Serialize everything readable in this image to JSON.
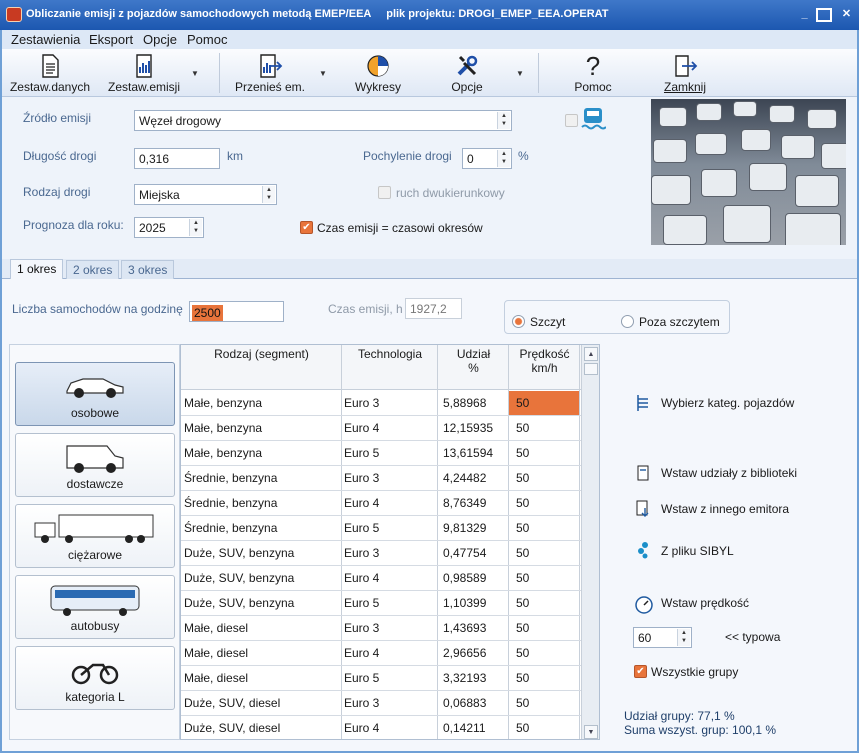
{
  "title_bar": {
    "text": "Obliczanie emisji z pojazdów samochodowych metodą EMEP/EEA     plik projektu: DROGI_EMEP_EEA.OPERAT"
  },
  "menu": [
    "Zestawienia",
    "Eksport",
    "Opcje",
    "Pomoc"
  ],
  "toolbar": {
    "zestaw_danych": "Zestaw.danych",
    "zestaw_emisji": "Zestaw.emisji",
    "przenies": "Przenieś em.",
    "wykresy": "Wykresy",
    "opcje": "Opcje",
    "pomoc": "Pomoc",
    "zamknij": "Zamknij"
  },
  "form": {
    "zrodlo_label": "Źródło emisji",
    "zrodlo_value": "Węzeł drogowy",
    "dlugosc_label": "Długość drogi",
    "dlugosc_value": "0,316",
    "dlugosc_unit": "km",
    "pochylenie_label": "Pochylenie drogi",
    "pochylenie_value": "0",
    "pochylenie_unit": "%",
    "rodzaj_label": "Rodzaj drogi",
    "rodzaj_value": "Miejska",
    "dwukierunkowy_label": "ruch dwukierunkowy",
    "prognoza_label": "Prognoza dla roku:",
    "prognoza_value": "2025",
    "czas_emisji_check_label": "Czas emisji = czasowi okresów"
  },
  "tabs": [
    "1 okres",
    "2 okres",
    "3 okres"
  ],
  "period": {
    "liczba_label": "Liczba samochodów na godzinę",
    "liczba_value": "2500",
    "czas_label": "Czas emisji, h",
    "czas_value": "1927,2",
    "radio_szczyt": "Szczyt",
    "radio_poza": "Poza szczytem"
  },
  "categories": [
    "osobowe",
    "dostawcze",
    "ciężarowe",
    "autobusy",
    "kategoria L"
  ],
  "grid": {
    "headers": {
      "rodzaj": "Rodzaj (segment)",
      "technologia": "Technologia",
      "udzial": "Udział\n%",
      "predkosc": "Prędkość\nkm/h"
    },
    "rows": [
      [
        "Małe, benzyna",
        "Euro 3",
        "5,88968",
        "50"
      ],
      [
        "Małe, benzyna",
        "Euro 4",
        "12,15935",
        "50"
      ],
      [
        "Małe, benzyna",
        "Euro 5",
        "13,61594",
        "50"
      ],
      [
        "Średnie, benzyna",
        "Euro 3",
        "4,24482",
        "50"
      ],
      [
        "Średnie, benzyna",
        "Euro 4",
        "8,76349",
        "50"
      ],
      [
        "Średnie, benzyna",
        "Euro 5",
        "9,81329",
        "50"
      ],
      [
        "Duże, SUV, benzyna",
        "Euro 3",
        "0,47754",
        "50"
      ],
      [
        "Duże, SUV, benzyna",
        "Euro 4",
        "0,98589",
        "50"
      ],
      [
        "Duże, SUV, benzyna",
        "Euro 5",
        "1,10399",
        "50"
      ],
      [
        "Małe, diesel",
        "Euro 3",
        "1,43693",
        "50"
      ],
      [
        "Małe, diesel",
        "Euro 4",
        "2,96656",
        "50"
      ],
      [
        "Małe, diesel",
        "Euro 5",
        "3,32193",
        "50"
      ],
      [
        "Duże, SUV, diesel",
        "Euro 3",
        "0,06883",
        "50"
      ],
      [
        "Duże, SUV, diesel",
        "Euro 4",
        "0,14211",
        "50"
      ]
    ]
  },
  "actions": {
    "wybierz": "Wybierz kateg. pojazdów",
    "wstaw_udzialy": "Wstaw udziały z biblioteki",
    "wstaw_innego": "Wstaw z innego emitora",
    "z_pliku": "Z pliku SIBYL",
    "wstaw_predkosc": "Wstaw prędkość",
    "speed_value": "60",
    "typowa": "<< typowa",
    "wszystkie": "Wszystkie grupy"
  },
  "summary": {
    "udzial_grupy": "Udział grupy: 77,1 %",
    "suma": "Suma wszyst. grup: 100,1 %"
  },
  "colors": {
    "accent": "#e8743b",
    "title_bar": "#1c57b0",
    "label": "#4a6890"
  }
}
